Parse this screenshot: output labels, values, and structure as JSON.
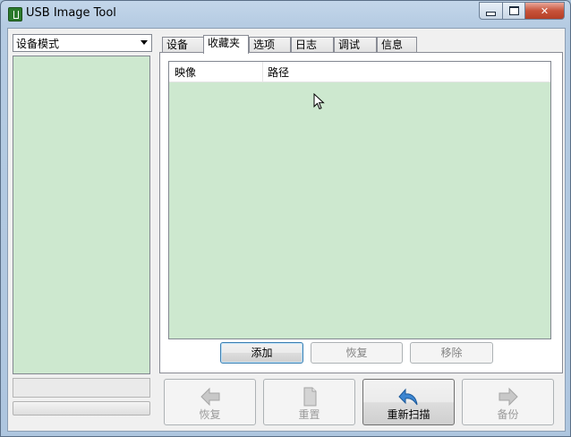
{
  "window": {
    "title": "USB Image Tool",
    "minimize": "▭",
    "maximize": "□",
    "close": "✕"
  },
  "left_panel": {
    "mode_select": {
      "value": "设备模式"
    },
    "progress": 0
  },
  "tabs": [
    "设备",
    "收藏夹",
    "选项",
    "日志",
    "调试",
    "信息"
  ],
  "active_tab": "收藏夹",
  "favorites": {
    "columns": [
      "映像",
      "路径"
    ],
    "rows": []
  },
  "panel_buttons": {
    "add": "添加",
    "restore": "恢复",
    "remove": "移除"
  },
  "actions": {
    "restore": "恢复",
    "reset": "重置",
    "rescan": "重新扫描",
    "backup": "备份"
  },
  "colors": {
    "list_background": "#cde8cf",
    "accent": "#3c7fb1",
    "rescan_icon": "#2f78c4"
  }
}
